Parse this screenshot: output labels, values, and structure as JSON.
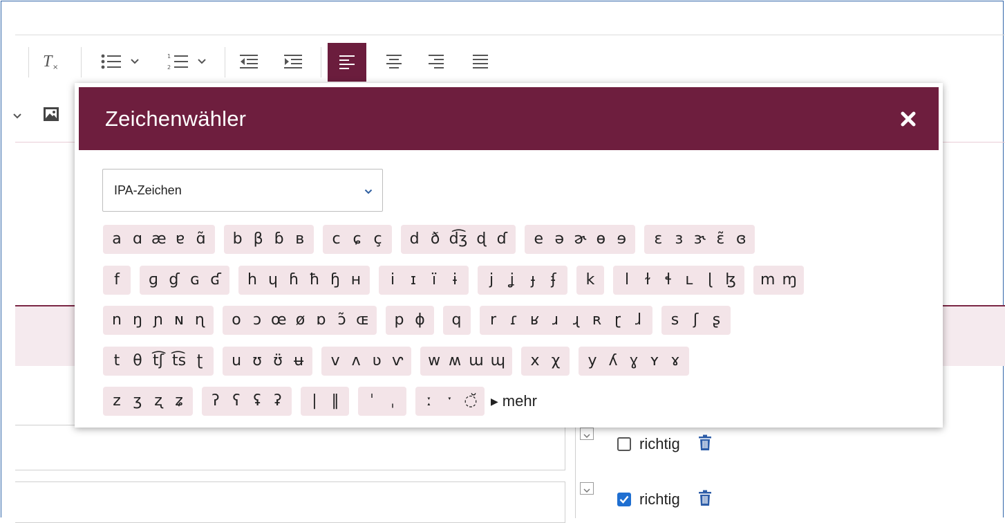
{
  "dialog": {
    "title": "Zeichenwähler",
    "close_icon": "close-icon",
    "category": {
      "selected": "IPA-Zeichen",
      "arrow_icon": "chevron-down-icon"
    },
    "more_label": "mehr",
    "more_icon": "triangle-right-icon",
    "character_rows": [
      [
        [
          "a",
          "ɑ",
          "æ",
          "ɐ",
          "ɑ̃"
        ],
        [
          "b",
          "β",
          "ɓ",
          "ʙ"
        ],
        [
          "c",
          "ɕ",
          "ç"
        ],
        [
          "d",
          "ð",
          "d͡ʒ",
          "ɖ",
          "ɗ"
        ],
        [
          "e",
          "ə",
          "ɚ",
          "ɵ",
          "ɘ"
        ],
        [
          "ɛ",
          "ɜ",
          "ɝ",
          "ɛ̃",
          "ɞ"
        ]
      ],
      [
        [
          "f"
        ],
        [
          "ɡ",
          "ɠ",
          "ɢ",
          "ʛ"
        ],
        [
          "h",
          "ɥ",
          "ɦ",
          "ħ",
          "ɧ",
          "ʜ"
        ],
        [
          "i",
          "ɪ",
          "ï",
          "ɨ"
        ],
        [
          "j",
          "ʝ",
          "ɟ",
          "ʄ"
        ],
        [
          "k"
        ],
        [
          "l",
          "ɫ",
          "ɬ",
          "ʟ",
          "ɭ",
          "ɮ"
        ],
        [
          "m",
          "ɱ"
        ]
      ],
      [
        [
          "n",
          "ŋ",
          "ɲ",
          "ɴ",
          "ɳ"
        ],
        [
          "o",
          "ɔ",
          "œ",
          "ø",
          "ɒ",
          "ɔ̃",
          "ɶ"
        ],
        [
          "p",
          "ɸ"
        ],
        [
          "q"
        ],
        [
          "r",
          "ɾ",
          "ʁ",
          "ɹ",
          "ɻ",
          "ʀ",
          "ɽ",
          "ɺ"
        ],
        [
          "s",
          "ʃ",
          "ʂ"
        ]
      ],
      [
        [
          "t",
          "θ",
          "t͡ʃ",
          "t͡s",
          "ʈ"
        ],
        [
          "u",
          "ʊ",
          "ʊ̈",
          "ʉ"
        ],
        [
          "v",
          "ʌ",
          "ʋ",
          "ⱱ"
        ],
        [
          "w",
          "ʍ",
          "ɯ",
          "ɰ"
        ],
        [
          "x",
          "χ"
        ],
        [
          "y",
          "ʎ",
          "ɣ",
          "ʏ",
          "ɤ"
        ]
      ],
      [
        [
          "z",
          "ʒ",
          "ʐ",
          "ʑ"
        ],
        [
          "ʔ",
          "ʕ",
          "ʢ",
          "ʡ"
        ],
        [
          "|",
          "‖"
        ],
        [
          "ˈ",
          "ˌ"
        ],
        [
          "ː",
          "ˑ",
          "◌̆"
        ]
      ]
    ]
  },
  "toolbar": {
    "icons": [
      "clear-format-icon",
      "bullet-list-icon",
      "numbered-list-icon",
      "outdent-icon",
      "indent-icon",
      "align-left-icon",
      "align-center-icon",
      "align-right-icon",
      "align-justify-icon",
      "image-icon"
    ],
    "active": "align-left-icon",
    "accent": "#6b1d3d"
  },
  "answers": [
    {
      "label": "richtig",
      "checked": false
    },
    {
      "label": "richtig",
      "checked": true
    }
  ],
  "colors": {
    "header": "#6e1e3e",
    "chip": "#f3e4e8",
    "checkbox": "#1f6fd1",
    "trash": "#2d5da8",
    "border": "#2f64a8"
  }
}
